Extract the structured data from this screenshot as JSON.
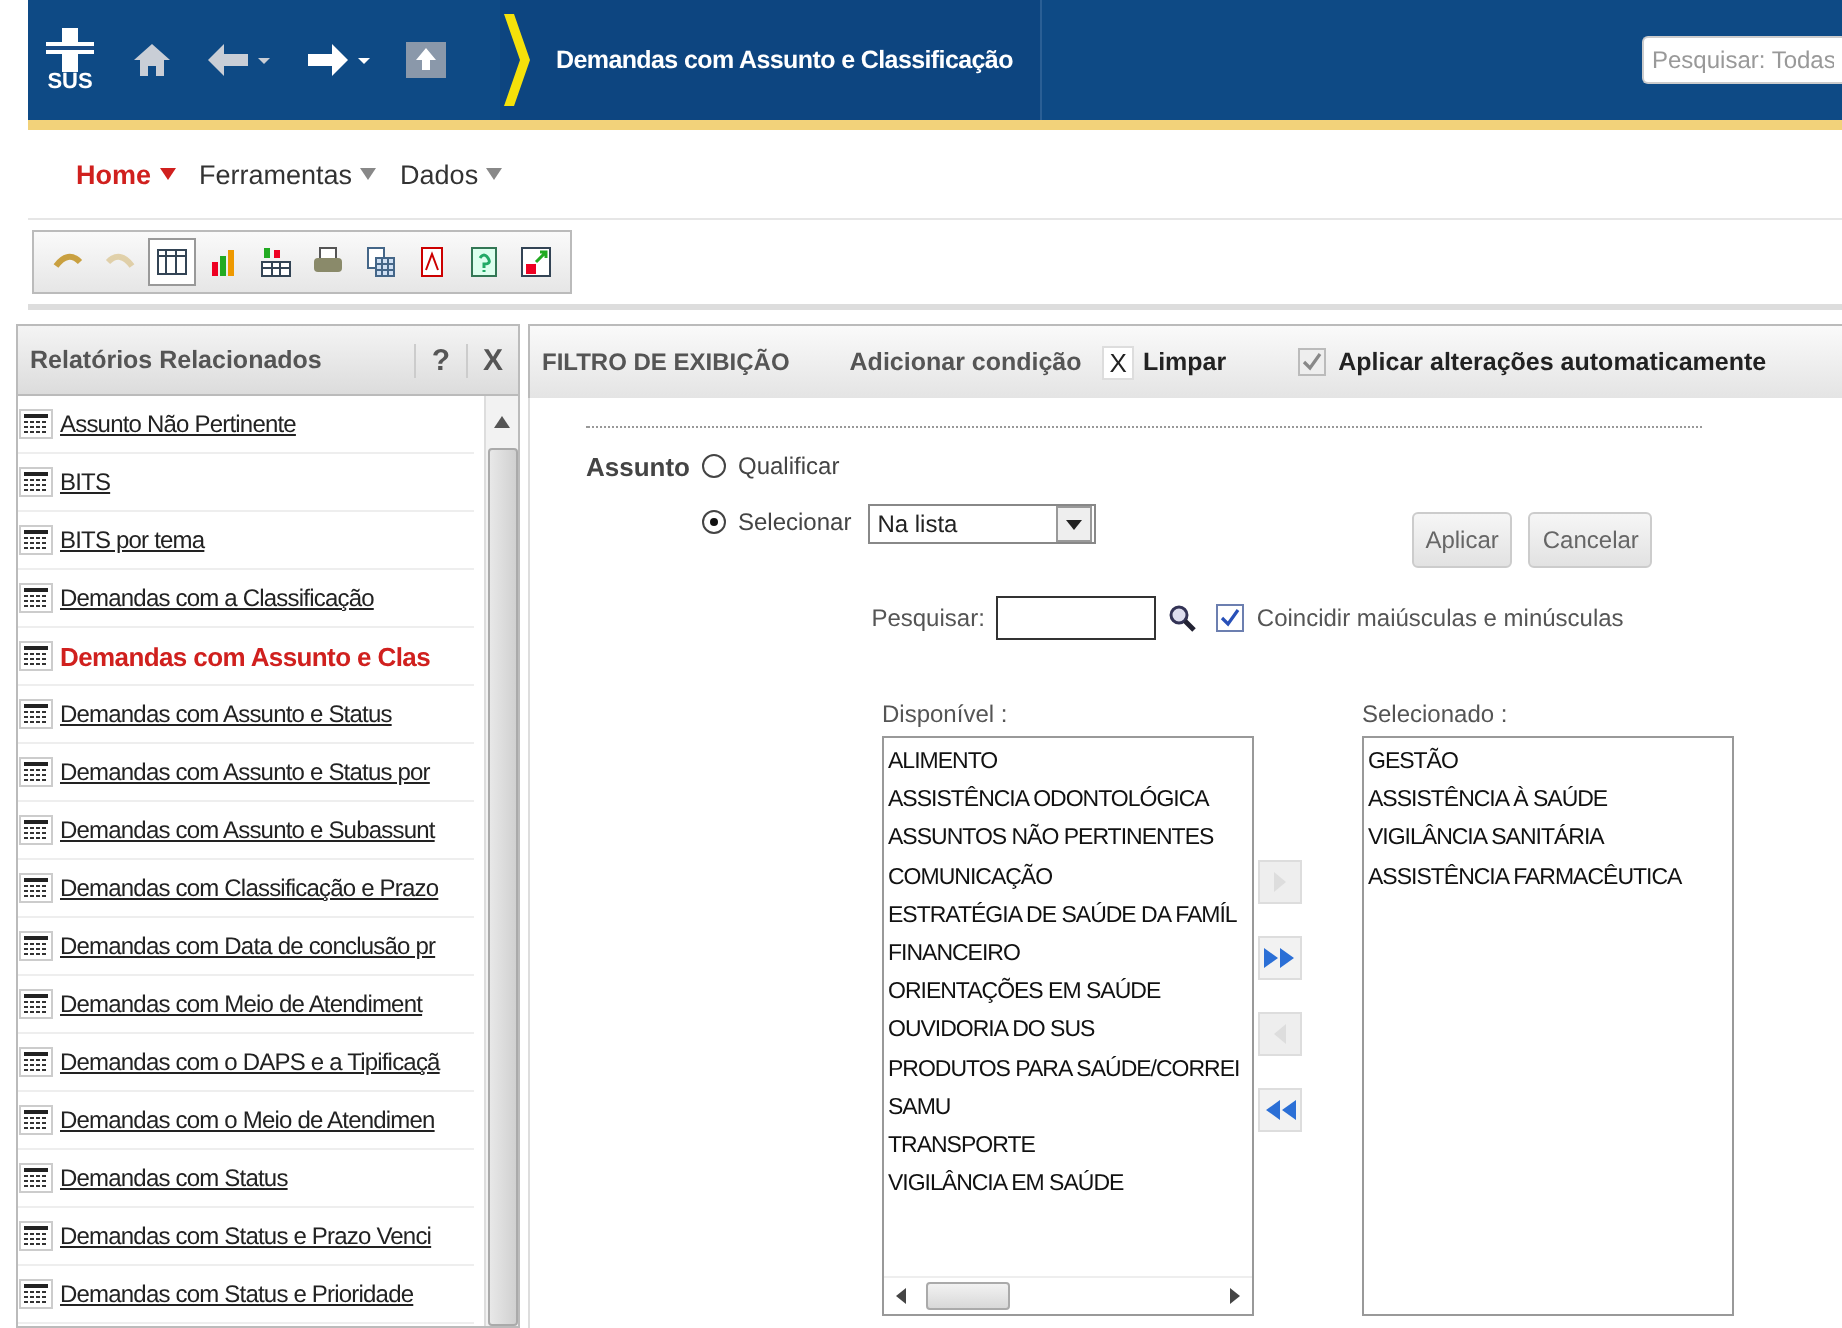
{
  "header": {
    "logo": "SUS",
    "title": "Demandas com Assunto e Classificação",
    "search_placeholder": "Pesquisar: Todas"
  },
  "menu": [
    {
      "label": "Home",
      "selected": true
    },
    {
      "label": "Ferramentas",
      "selected": false
    },
    {
      "label": "Dados",
      "selected": false
    }
  ],
  "toolbar": [
    {
      "kind": "undo",
      "disabled": false,
      "selected": false
    },
    {
      "kind": "redo",
      "disabled": true,
      "selected": false
    },
    {
      "kind": "table",
      "disabled": false,
      "selected": true
    },
    {
      "kind": "chart",
      "disabled": false,
      "selected": false
    },
    {
      "kind": "tablechart",
      "disabled": false,
      "selected": false
    },
    {
      "kind": "print",
      "disabled": false,
      "selected": false
    },
    {
      "kind": "grid",
      "disabled": false,
      "selected": false
    },
    {
      "kind": "pdf",
      "disabled": false,
      "selected": false
    },
    {
      "kind": "help",
      "disabled": false,
      "selected": false
    },
    {
      "kind": "export",
      "disabled": false,
      "selected": false
    }
  ],
  "sidebar": {
    "title": "Relatórios Relacionados",
    "help": "?",
    "close": "X",
    "items": [
      {
        "label": "Assunto Não Pertinente",
        "selected": false
      },
      {
        "label": "BITS",
        "selected": false
      },
      {
        "label": "BITS por tema",
        "selected": false
      },
      {
        "label": "Demandas com a Classificação",
        "selected": false
      },
      {
        "label": "Demandas com Assunto e Clas",
        "selected": true
      },
      {
        "label": "Demandas com Assunto e Status",
        "selected": false
      },
      {
        "label": "Demandas com Assunto e Status por",
        "selected": false
      },
      {
        "label": "Demandas com Assunto e Subassunt",
        "selected": false
      },
      {
        "label": "Demandas com Classificação e Prazo",
        "selected": false
      },
      {
        "label": "Demandas com Data de conclusão pr",
        "selected": false
      },
      {
        "label": "Demandas com Meio de Atendiment",
        "selected": false
      },
      {
        "label": "Demandas com o DAPS e a Tipificaçã",
        "selected": false
      },
      {
        "label": "Demandas com o Meio de Atendimen",
        "selected": false
      },
      {
        "label": "Demandas com Status",
        "selected": false
      },
      {
        "label": "Demandas com Status e Prazo Venci",
        "selected": false
      },
      {
        "label": "Demandas com Status e Prioridade",
        "selected": false
      }
    ]
  },
  "filter": {
    "title": "FILTRO DE EXIBIÇÃO",
    "add": "Adicionar condição",
    "clear_icon": "X",
    "clear": "Limpar",
    "auto_apply": {
      "label": "Aplicar alterações automaticamente",
      "checked": true,
      "disabled": true
    },
    "field": "Assunto",
    "modes": [
      {
        "label": "Qualificar",
        "selected": false
      },
      {
        "label": "Selecionar",
        "selected": true
      }
    ],
    "operator": "Na lista",
    "apply": "Aplicar",
    "cancel": "Cancelar",
    "search_label": "Pesquisar:",
    "match_case": {
      "label": "Coincidir maiúsculas e minúsculas",
      "checked": true
    },
    "available_label": "Disponível :",
    "available": [
      "ALIMENTO",
      "ASSISTÊNCIA ODONTOLÓGICA",
      "ASSUNTOS NÃO PERTINENTES",
      "COMUNICAÇÃO",
      "ESTRATÉGIA DE SAÚDE DA FAMÍL",
      "FINANCEIRO",
      "ORIENTAÇÕES EM SAÚDE",
      "OUVIDORIA DO SUS",
      "PRODUTOS PARA SAÚDE/CORREI",
      "SAMU",
      "TRANSPORTE",
      "VIGILÂNCIA EM SAÚDE"
    ],
    "transfer": [
      {
        "kind": "add",
        "disabled": true
      },
      {
        "kind": "add-all",
        "disabled": false
      },
      {
        "kind": "remove",
        "disabled": true
      },
      {
        "kind": "remove-all",
        "disabled": false
      }
    ],
    "selected_label": "Selecionado :",
    "selected": [
      "GESTÃO",
      "ASSISTÊNCIA À SAÚDE",
      "VIGILÂNCIA SANITÁRIA",
      "ASSISTÊNCIA FARMACÊUTICA"
    ]
  }
}
